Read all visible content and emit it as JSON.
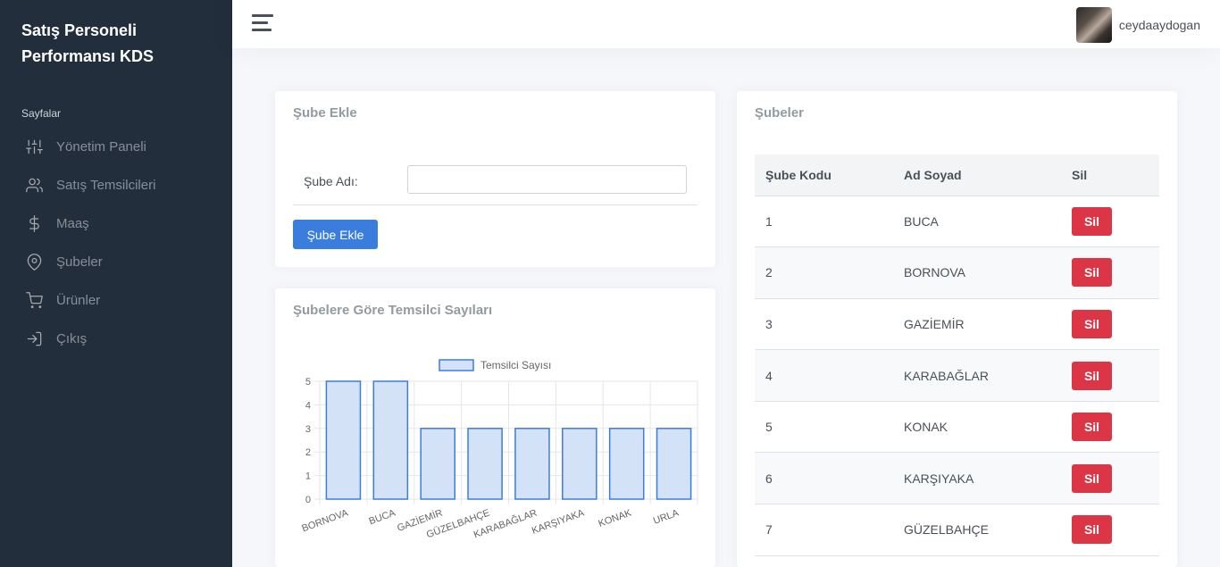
{
  "sidebar": {
    "brand": "Satış Personeli Performansı KDS",
    "header": "Sayfalar",
    "items": [
      {
        "label": "Yönetim Paneli",
        "icon": "sliders-icon"
      },
      {
        "label": "Satış Temsilcileri",
        "icon": "users-icon"
      },
      {
        "label": "Maaş",
        "icon": "dollar-icon"
      },
      {
        "label": "Şubeler",
        "icon": "map-pin-icon"
      },
      {
        "label": "Ürünler",
        "icon": "cart-icon"
      },
      {
        "label": "Çıkış",
        "icon": "log-in-icon"
      }
    ]
  },
  "topbar": {
    "username": "ceydaaydogan"
  },
  "add_branch": {
    "title": "Şube Ekle",
    "field_label": "Şube Adı:",
    "field_value": "",
    "button_label": "Şube Ekle"
  },
  "chart_card": {
    "title": "Şubelere Göre Temsilci Sayıları"
  },
  "chart_data": {
    "type": "bar",
    "categories": [
      "BORNOVA",
      "BUCA",
      "GAZİEMİR",
      "GÜZELBAHÇE",
      "KARABAĞLAR",
      "KARŞIYAKA",
      "KONAK",
      "URLA"
    ],
    "series": [
      {
        "name": "Temsilci Sayısı",
        "values": [
          5,
          5,
          3,
          3,
          3,
          3,
          3,
          3
        ]
      }
    ],
    "ylim": [
      0,
      5
    ],
    "yticks": [
      0,
      1,
      2,
      3,
      4,
      5
    ],
    "legend": "top",
    "grid": true,
    "bar_fill": "#d4e2f7",
    "bar_stroke": "#3b7ddd"
  },
  "branches": {
    "title": "Şubeler",
    "columns": [
      "Şube Kodu",
      "Ad Soyad",
      "Sil"
    ],
    "delete_label": "Sil",
    "rows": [
      {
        "code": "1",
        "name": "BUCA"
      },
      {
        "code": "2",
        "name": "BORNOVA"
      },
      {
        "code": "3",
        "name": "GAZİEMİR"
      },
      {
        "code": "4",
        "name": "KARABAĞLAR"
      },
      {
        "code": "5",
        "name": "KONAK"
      },
      {
        "code": "6",
        "name": "KARŞIYAKA"
      },
      {
        "code": "7",
        "name": "GÜZELBAHÇE"
      }
    ]
  },
  "colors": {
    "sidebar_bg": "#222e3c",
    "primary": "#3b7ddd",
    "danger": "#dc3545",
    "page_bg": "#f5f7fb"
  }
}
